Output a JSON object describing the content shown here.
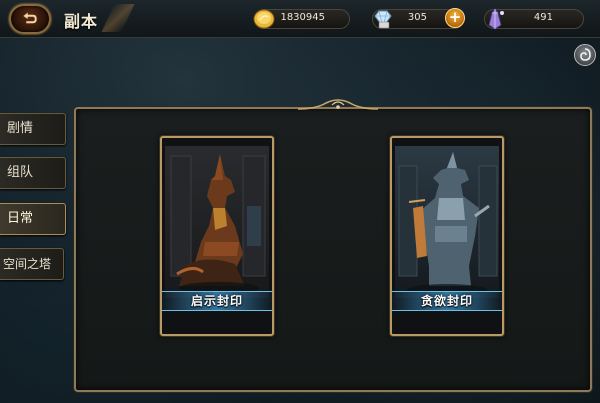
{
  "header": {
    "title": "副本",
    "back_icon": "back-arrow-icon"
  },
  "resources": {
    "gold": {
      "icon": "gold-coin-icon",
      "value": "1830945"
    },
    "diamond": {
      "icon": "diamond-icon",
      "value": "305"
    },
    "plus_label": "+",
    "crystal": {
      "icon": "purple-crystal-icon",
      "value": "491"
    }
  },
  "settings": {
    "icon": "swirl-settings-icon"
  },
  "sidebar": {
    "tabs": [
      {
        "label": "剧情",
        "active": false
      },
      {
        "label": "组队",
        "active": false
      },
      {
        "label": "日常",
        "active": true
      },
      {
        "label": "空间之塔",
        "active": false
      }
    ]
  },
  "dungeons": [
    {
      "name": "启示封印",
      "art": "anubis-jackal-statue"
    },
    {
      "name": "贪欲封印",
      "art": "anubis-guardian-warrior"
    }
  ],
  "colors": {
    "frame_gold": "#b99a66",
    "label_blue": "#3c8cbe",
    "background": "#142028"
  }
}
